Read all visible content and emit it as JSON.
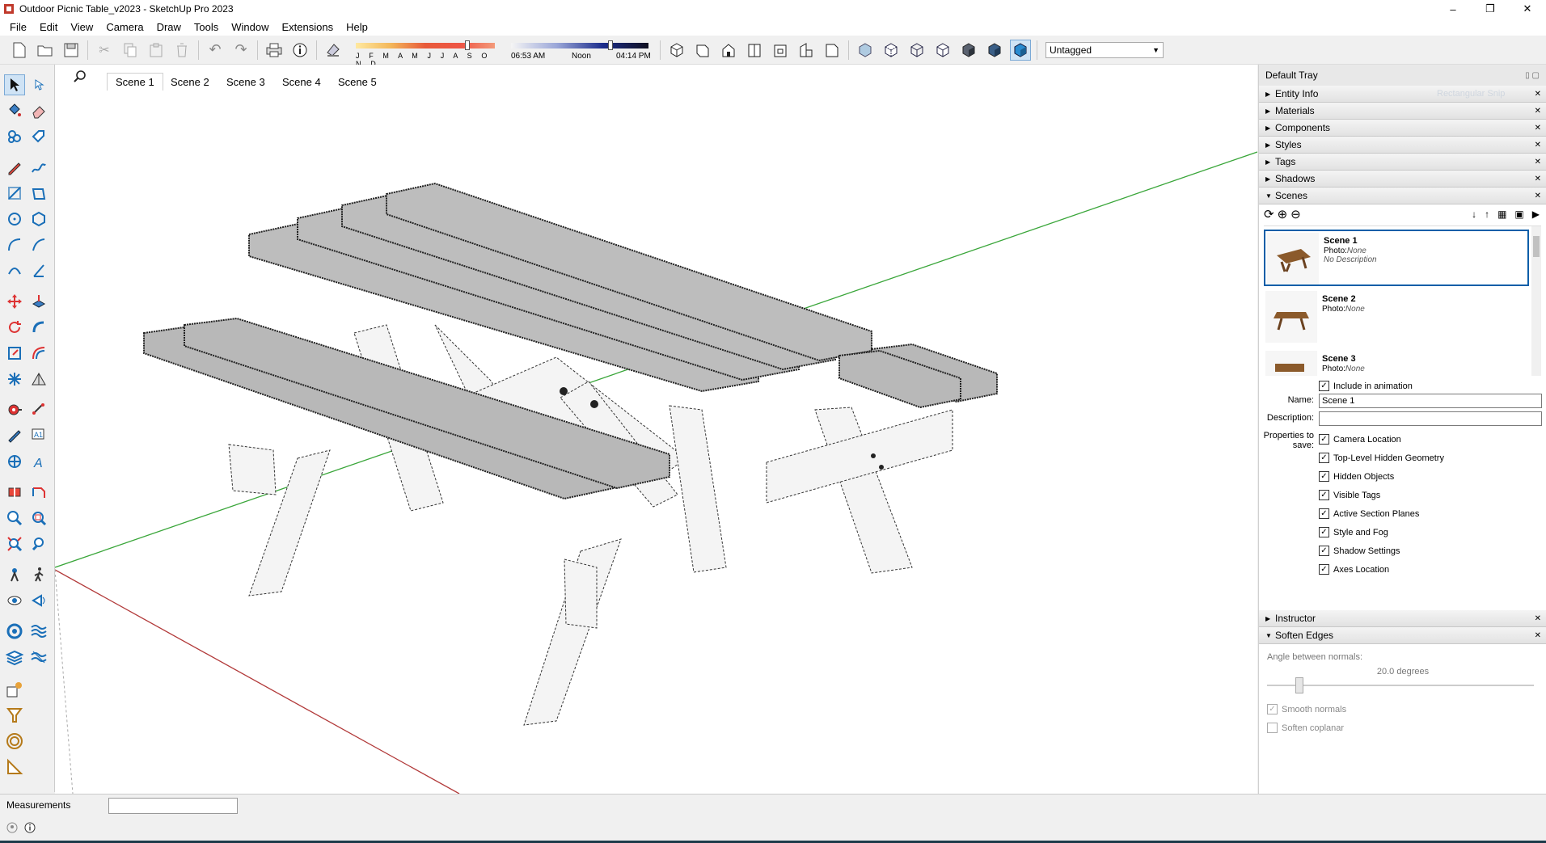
{
  "window": {
    "title": "Outdoor Picnic Table_v2023 - SketchUp Pro 2023",
    "minimize": "–",
    "maximize": "❐",
    "close": "✕"
  },
  "menu": [
    "File",
    "Edit",
    "View",
    "Camera",
    "Draw",
    "Tools",
    "Window",
    "Extensions",
    "Help"
  ],
  "shadow": {
    "months": "J F M A M J J A S O N D",
    "time_start": "06:53 AM",
    "time_mid": "Noon",
    "time_end": "04:14 PM"
  },
  "tag_select": {
    "value": "Untagged"
  },
  "scene_tabs": [
    "Scene 1",
    "Scene 2",
    "Scene 3",
    "Scene 4",
    "Scene 5"
  ],
  "active_scene_tab": "Scene 1",
  "tray": {
    "title": "Default Tray",
    "ghost_hint": "Rectangular Snip",
    "panels_top": [
      "Entity Info",
      "Materials",
      "Components",
      "Styles",
      "Tags",
      "Shadows"
    ],
    "scenes_panel": "Scenes",
    "scenes": [
      {
        "name": "Scene 1",
        "photo_label": "Photo:",
        "photo": "None",
        "desc": "No Description"
      },
      {
        "name": "Scene 2",
        "photo_label": "Photo:",
        "photo": "None",
        "desc": ""
      },
      {
        "name": "Scene 3",
        "photo_label": "Photo:",
        "photo": "None",
        "desc": ""
      }
    ],
    "include_animation": "Include in animation",
    "name_label": "Name:",
    "name_value": "Scene 1",
    "description_label": "Description:",
    "description_value": "",
    "properties_label": "Properties to save:",
    "properties": [
      "Camera Location",
      "Top-Level Hidden Geometry",
      "Hidden Objects",
      "Visible Tags",
      "Active Section Planes",
      "Style and Fog",
      "Shadow Settings",
      "Axes Location"
    ],
    "instructor": "Instructor",
    "soften_edges": "Soften Edges",
    "angle_label": "Angle between normals:",
    "angle_value": "20.0  degrees",
    "angle_fraction": 0.11,
    "smooth_normals": "Smooth normals",
    "soften_coplanar": "Soften coplanar"
  },
  "status": {
    "measurements_label": "Measurements"
  },
  "colors": {
    "accent": "#0b5ea8",
    "green_axis": "#3aa63a",
    "red_axis": "#b23a3a"
  }
}
